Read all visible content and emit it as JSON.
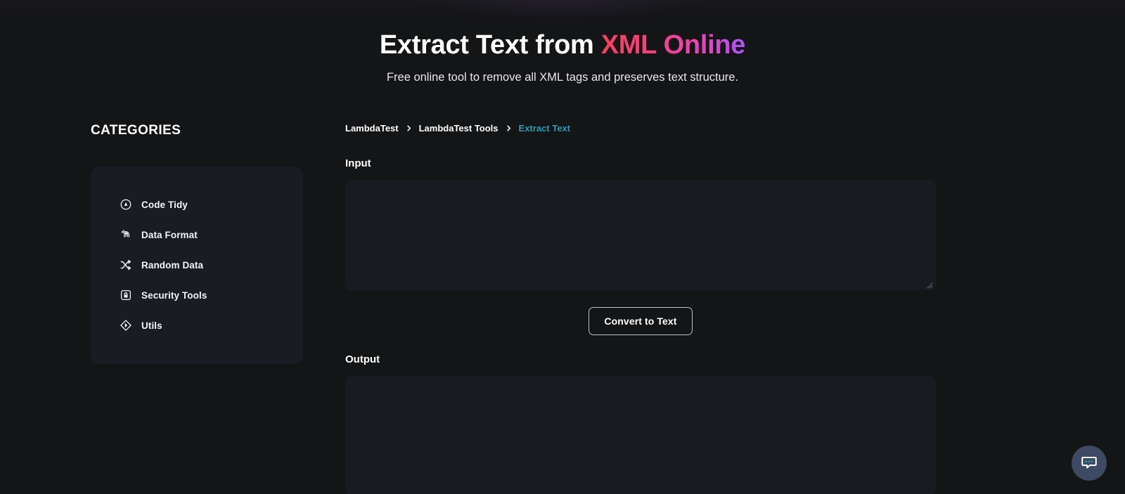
{
  "hero": {
    "title_plain": "Extract Text from ",
    "title_accent": "XML Online",
    "subtitle": "Free online tool to remove all XML tags and preserves text structure.",
    "accent_from": "#f43f5e",
    "accent_to": "#a855f7"
  },
  "sidebar": {
    "heading": "CATEGORIES",
    "items": [
      {
        "label": "Code Tidy",
        "icon": "code-tidy-icon"
      },
      {
        "label": "Data Format",
        "icon": "fingerprint-icon"
      },
      {
        "label": "Random Data",
        "icon": "shuffle-icon"
      },
      {
        "label": "Security Tools",
        "icon": "lock-icon"
      },
      {
        "label": "Utils",
        "icon": "diamond-tag-icon"
      }
    ]
  },
  "breadcrumb": {
    "items": [
      {
        "label": "LambdaTest",
        "current": false
      },
      {
        "label": "LambdaTest Tools",
        "current": false
      },
      {
        "label": "Extract Text",
        "current": true
      }
    ],
    "separator": "›",
    "current_color": "#2f9bb5"
  },
  "main": {
    "input_label": "Input",
    "input_value": "",
    "input_placeholder": "",
    "convert_button": "Convert to Text",
    "output_label": "Output",
    "output_value": "",
    "output_placeholder": ""
  },
  "chat": {
    "label": "chat-widget",
    "bubble_color": "#3e4a63",
    "dot_color": "#2fb6c4"
  }
}
